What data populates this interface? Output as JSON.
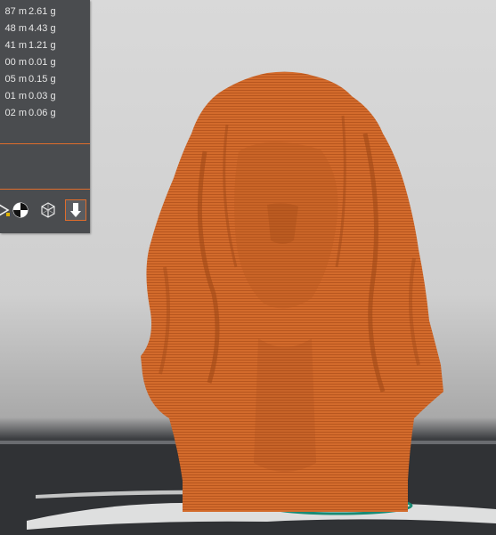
{
  "stats": {
    "rows": [
      {
        "length": "87 m",
        "weight": "2.61 g"
      },
      {
        "length": "48 m",
        "weight": "4.43 g"
      },
      {
        "length": "41 m",
        "weight": "1.21 g"
      },
      {
        "length": "00 m",
        "weight": "0.01 g"
      },
      {
        "length": "05 m",
        "weight": "0.15 g"
      },
      {
        "length": "01 m",
        "weight": "0.03 g"
      },
      {
        "length": "02 m",
        "weight": "0.06 g"
      }
    ]
  },
  "toolbar": {
    "icons": [
      "view-mode-icon",
      "center-of-mass-icon",
      "wireframe-cube-icon",
      "export-icon"
    ]
  },
  "colors": {
    "panel_bg": "#4a4c4f",
    "accent": "#e06d2c",
    "model": "#d06a2b",
    "bed": "#2f3134",
    "skirt": "#1a8a73"
  }
}
